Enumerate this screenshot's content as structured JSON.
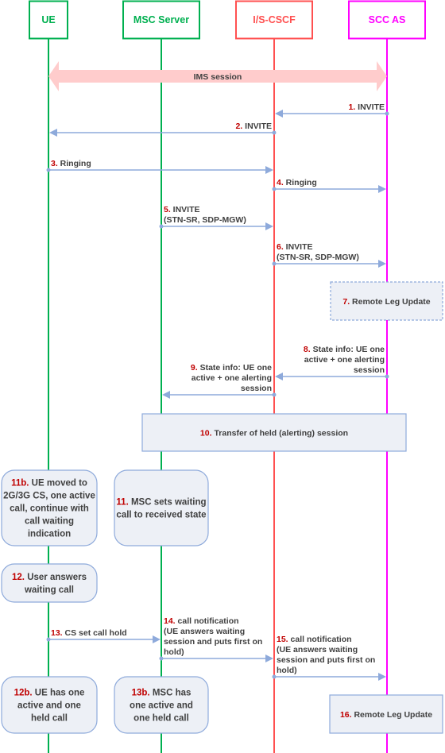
{
  "diagram": {
    "type": "sequence-diagram",
    "colors": {
      "ue": "#00b050",
      "msc": "#00b050",
      "cscf": "#ff5050",
      "sccas": "#ff00ff",
      "arrow": "#8eaadb",
      "step_number": "#c00000",
      "text": "#404040",
      "box_fill": "#edf0f6",
      "box_border": "#8eaadb",
      "session_fill": "#ffcccc"
    },
    "entities": [
      {
        "id": "ue",
        "label": "UE"
      },
      {
        "id": "msc",
        "label": "MSC Server"
      },
      {
        "id": "cscf",
        "label": "I/S-CSCF"
      },
      {
        "id": "sccas",
        "label": "SCC AS"
      }
    ],
    "session": {
      "label": "IMS session",
      "from": "ue",
      "to": "sccas"
    },
    "messages": [
      {
        "num": "1.",
        "lines": [
          "INVITE"
        ],
        "from": "sccas",
        "to": "cscf"
      },
      {
        "num": "2.",
        "lines": [
          "INVITE"
        ],
        "from": "cscf",
        "to": "ue"
      },
      {
        "num": "3.",
        "lines": [
          "Ringing"
        ],
        "from": "ue",
        "to": "cscf"
      },
      {
        "num": "4.",
        "lines": [
          "Ringing"
        ],
        "from": "cscf",
        "to": "sccas"
      },
      {
        "num": "5.",
        "lines": [
          "INVITE",
          "(STN-SR, SDP-MGW)"
        ],
        "from": "msc",
        "to": "cscf"
      },
      {
        "num": "6.",
        "lines": [
          "INVITE",
          "(STN-SR, SDP-MGW)"
        ],
        "from": "cscf",
        "to": "sccas"
      },
      {
        "num": "8.",
        "lines": [
          "State info: UE one",
          "active + one alerting",
          "session"
        ],
        "from": "sccas",
        "to": "cscf"
      },
      {
        "num": "9.",
        "lines": [
          "State info: UE one",
          "active + one alerting",
          "session"
        ],
        "from": "cscf",
        "to": "msc"
      },
      {
        "num": "13.",
        "lines": [
          "CS set call hold"
        ],
        "from": "ue",
        "to": "msc"
      },
      {
        "num": "14.",
        "lines": [
          "call notification",
          "(UE answers waiting",
          "session and puts first on",
          "hold)"
        ],
        "from": "msc",
        "to": "cscf"
      },
      {
        "num": "15.",
        "lines": [
          "call notification",
          "(UE answers waiting",
          "session and puts first on",
          "hold)"
        ],
        "from": "cscf",
        "to": "sccas"
      }
    ],
    "process_boxes": [
      {
        "num": "7.",
        "lines": [
          "Remote Leg Update"
        ],
        "style": "dashed"
      },
      {
        "num": "10.",
        "lines": [
          "Transfer of held (alerting) session"
        ],
        "style": "rect"
      },
      {
        "num": "16.",
        "lines": [
          "Remote Leg Update"
        ],
        "style": "rect"
      }
    ],
    "state_boxes": [
      {
        "num": "11b.",
        "lines": [
          "UE moved to",
          "2G/3G CS, one active",
          "call, continue with",
          "call waiting",
          "indication"
        ],
        "on": "ue"
      },
      {
        "num": "11.",
        "lines": [
          "MSC sets waiting",
          "call to received state"
        ],
        "on": "msc"
      },
      {
        "num": "12.",
        "lines": [
          "User answers",
          "waiting call"
        ],
        "on": "ue"
      },
      {
        "num": "12b.",
        "lines": [
          "UE has one",
          "active and one",
          "held call"
        ],
        "on": "ue"
      },
      {
        "num": "13b.",
        "lines": [
          "MSC has",
          "one active and",
          "one held call"
        ],
        "on": "msc"
      }
    ]
  }
}
